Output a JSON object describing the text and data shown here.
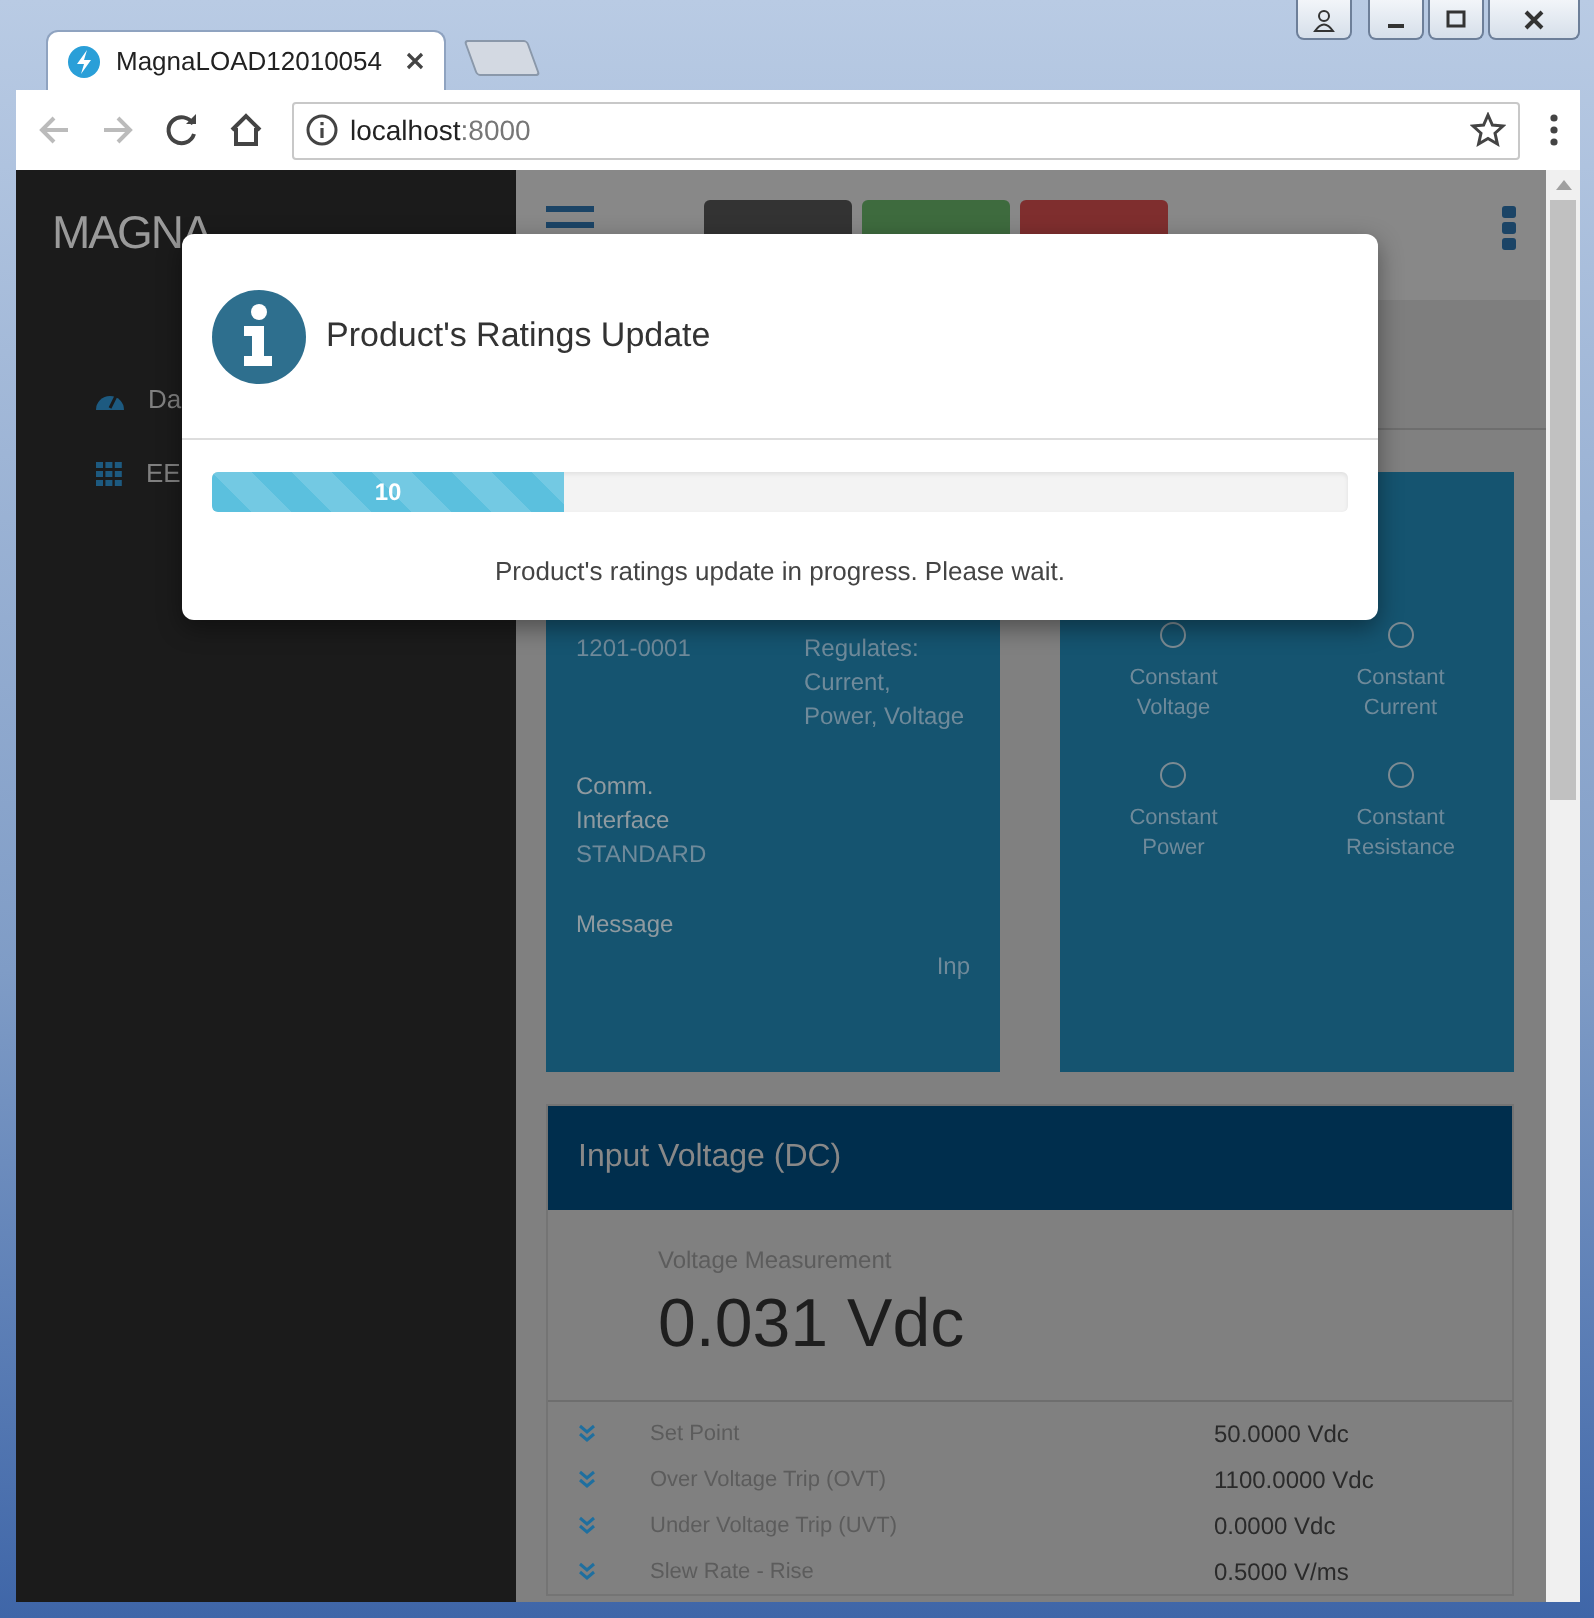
{
  "browser": {
    "tab_title": "MagnaLOAD12010054",
    "address_host": "localhost",
    "address_port": ":8000"
  },
  "sidebar": {
    "logo_left": "MAGNA",
    "items": [
      {
        "label": "Da",
        "kind": "dashboard"
      },
      {
        "label": "EE",
        "kind": "apps"
      }
    ]
  },
  "topbar": {
    "buttons": [
      {
        "kind": "clear"
      },
      {
        "kind": "start"
      },
      {
        "kind": "stop"
      }
    ]
  },
  "info_card": {
    "model": "1201-0001",
    "regulates": "Regulates: Current, Power, Voltage",
    "comm_label": "Comm. Interface",
    "comm_value": "STANDARD",
    "message_label": "Message",
    "message_value": "Inp"
  },
  "modes": [
    {
      "label": "Constant Voltage",
      "checked": false
    },
    {
      "label": "Constant Current",
      "checked": false
    },
    {
      "label": "Constant Power",
      "checked": false
    },
    {
      "label": "Constant Resistance",
      "checked": false
    }
  ],
  "input_voltage": {
    "title": "Input Voltage (DC)",
    "measurement_label": "Voltage Measurement",
    "measurement": "0.031 Vdc",
    "rows": [
      {
        "label": "Set Point",
        "value": "50.0000 Vdc"
      },
      {
        "label": "Over Voltage Trip (OVT)",
        "value": "1100.0000 Vdc"
      },
      {
        "label": "Under Voltage Trip (UVT)",
        "value": "0.0000 Vdc"
      },
      {
        "label": "Slew Rate - Rise",
        "value": "0.5000 V/ms"
      }
    ]
  },
  "modal": {
    "title": "Product's Ratings Update",
    "progress": {
      "level": 0.31,
      "label": "10"
    },
    "message": "Product's ratings update in progress. Please wait."
  }
}
